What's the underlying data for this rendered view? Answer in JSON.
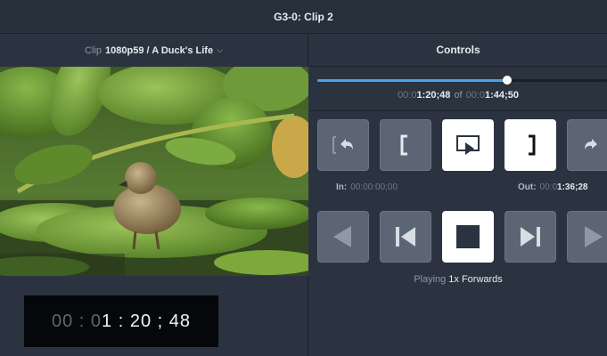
{
  "window": {
    "title": "G3-0: Clip 2"
  },
  "clip": {
    "label": "Clip",
    "value": "1080p59 / A Duck's Life"
  },
  "timecode": {
    "dim": "00 : 0",
    "bright": "1 : 20 ; 48"
  },
  "controls": {
    "title": "Controls",
    "progress": 0.791,
    "position": {
      "current_dim": "00:0",
      "current": "1:20;48",
      "of": "of",
      "total_dim": "00:0",
      "total": "1:44;50"
    },
    "in_point": {
      "label": "In:",
      "value": "00:00:00;00"
    },
    "out_point": {
      "label": "Out:",
      "value_dim": "00:0",
      "value": "1:36;28"
    },
    "status": {
      "label": "Playing",
      "value": "1x Forwards"
    }
  },
  "buttons": {
    "row1": [
      "undo-icon",
      "mark-in-icon",
      "play-to-monitor-icon",
      "mark-out-icon",
      "redo-icon"
    ],
    "row2": [
      "rewind-icon",
      "step-back-icon",
      "stop-icon",
      "step-forward-icon",
      "fast-forward-icon"
    ],
    "active": [
      "play-to-monitor-icon",
      "mark-out-icon",
      "stop-icon"
    ]
  },
  "colors": {
    "accent": "#4aa3e8",
    "background": "#2b3340",
    "button": "#5c6573"
  }
}
